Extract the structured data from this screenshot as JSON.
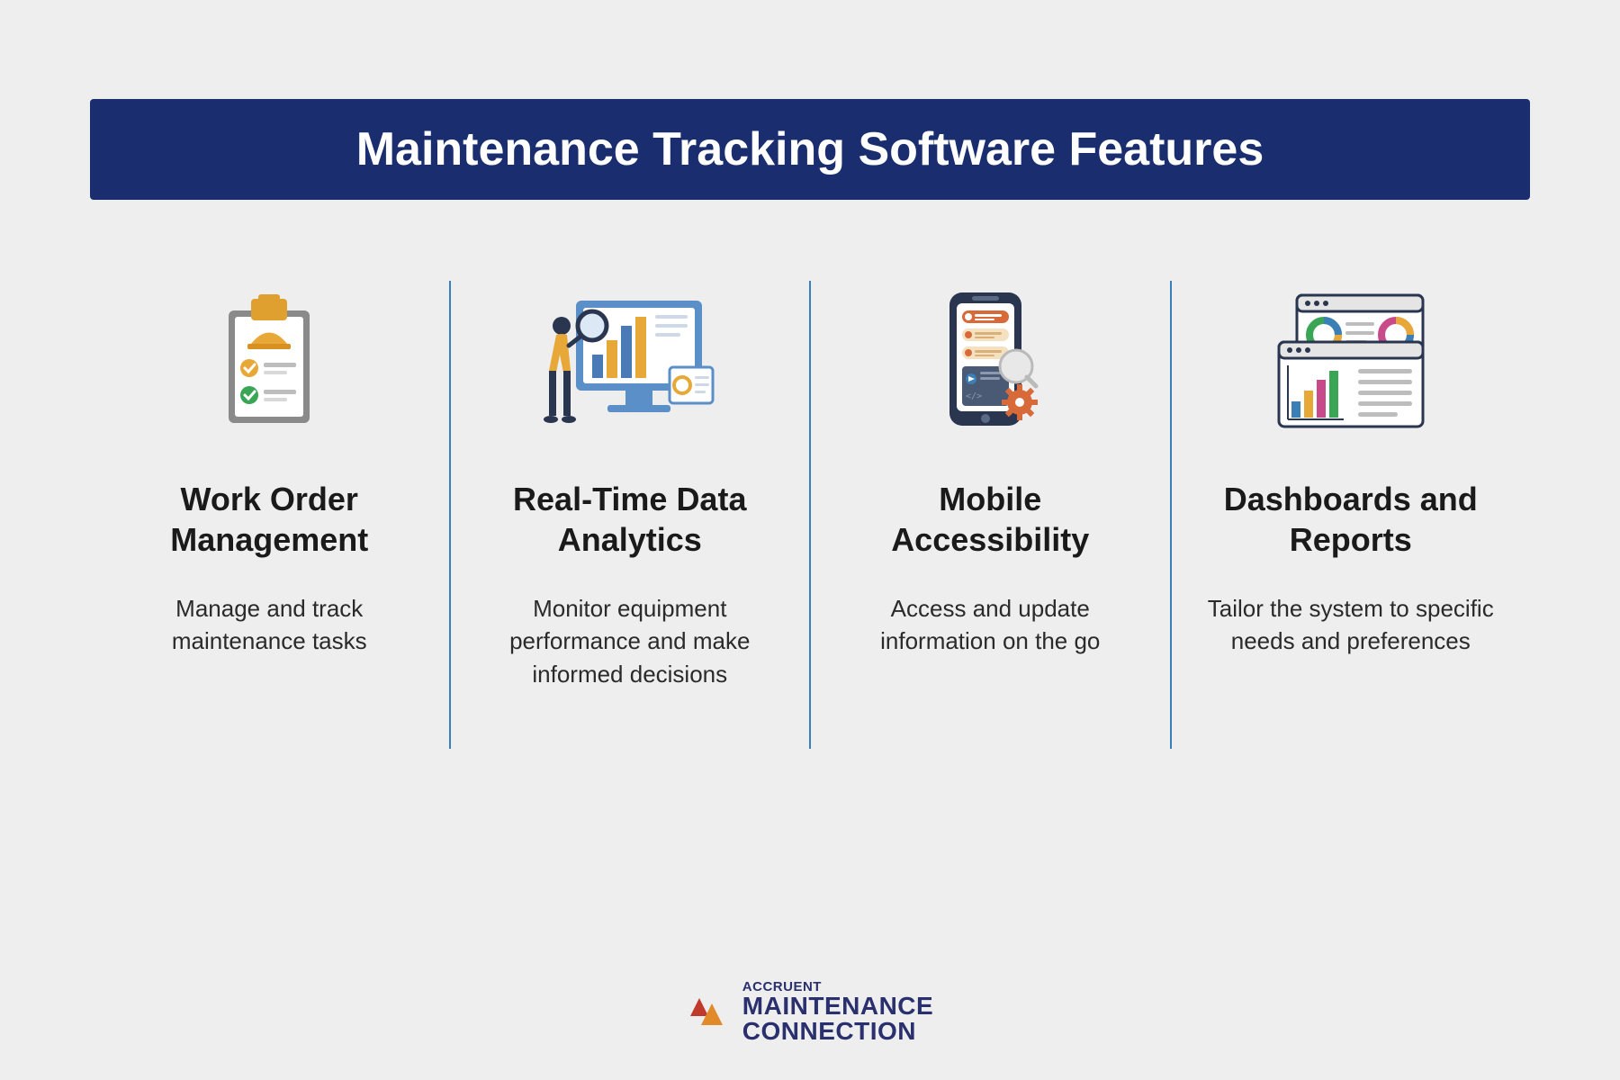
{
  "title": "Maintenance Tracking Software Features",
  "features": [
    {
      "title": "Work Order Management",
      "description": "Manage and track maintenance tasks",
      "icon": "clipboard-checklist-icon"
    },
    {
      "title": "Real-Time Data Analytics",
      "description": "Monitor equipment performance and make informed decisions",
      "icon": "analytics-monitor-icon"
    },
    {
      "title": "Mobile Accessibility",
      "description": "Access and update information on the go",
      "icon": "mobile-app-icon"
    },
    {
      "title": "Dashboards and Reports",
      "description": "Tailor the system to specific needs and preferences",
      "icon": "dashboard-report-icon"
    }
  ],
  "brand": {
    "small": "ACCRUENT",
    "line1": "MAINTENANCE",
    "line2": "CONNECTION"
  },
  "colors": {
    "banner": "#1a2e6f",
    "divider": "#3a7fb5",
    "brand_navy": "#2a2f6e",
    "brand_orange": "#e08a2a",
    "brand_red": "#c0392b"
  }
}
